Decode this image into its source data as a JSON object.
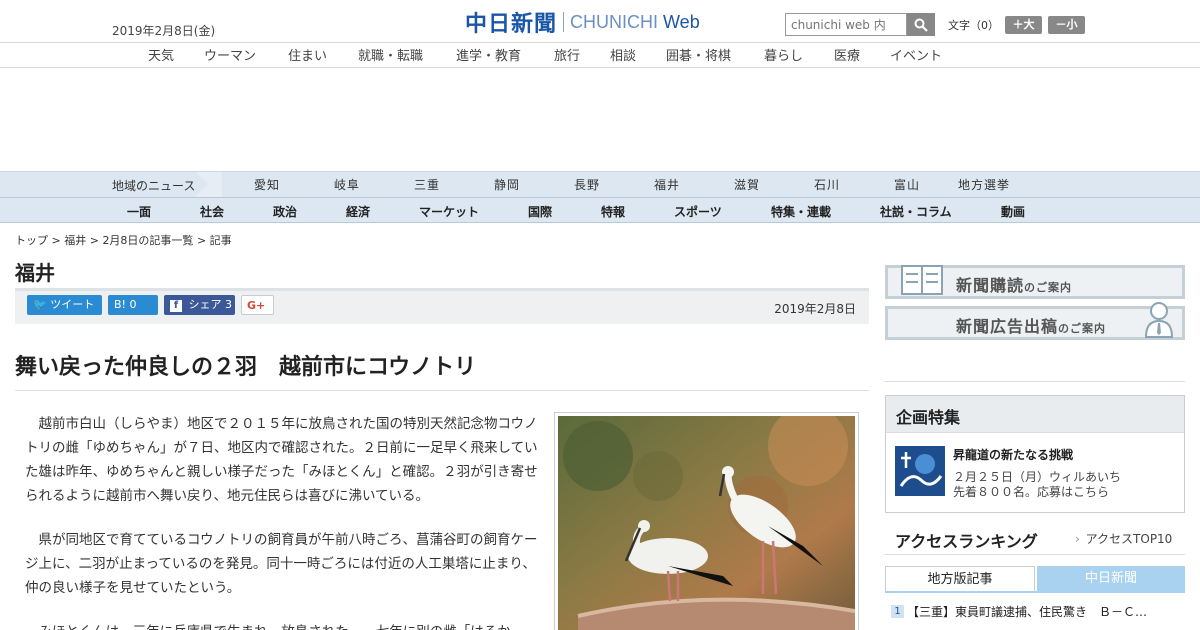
{
  "header": {
    "date": "2019年2月8日(金)",
    "logo_jp": "中日新聞",
    "logo_en": "CHUNICHI",
    "logo_web": "Web",
    "search_placeholder": "chunichi web 内",
    "font_label": "文字（0）",
    "font_up": "＋大",
    "font_down": "－小"
  },
  "global_nav": [
    "天気",
    "ウーマン",
    "住まい",
    "就職・転職",
    "進学・教育",
    "旅行",
    "相談",
    "囲碁・将棋",
    "暮らし",
    "医療",
    "イベント"
  ],
  "region_nav": {
    "label": "地域のニュース",
    "items": [
      "愛知",
      "岐阜",
      "三重",
      "静岡",
      "長野",
      "福井",
      "滋賀",
      "石川",
      "富山",
      "地方選挙"
    ]
  },
  "section_nav": [
    "一面",
    "社会",
    "政治",
    "経済",
    "マーケット",
    "国際",
    "特報",
    "スポーツ",
    "特集・連載",
    "社説・コラム",
    "動画"
  ],
  "breadcrumb": {
    "top": "トップ",
    "region": "福井",
    "list": "2月8日の記事一覧",
    "current": "記事",
    "sep": ">"
  },
  "section_title": "福井",
  "share": {
    "tweet": "ツイート",
    "hatena": "B! 0",
    "facebook": "シェア 3",
    "gplus": "G+",
    "date": "2019年2月8日"
  },
  "article": {
    "headline": "舞い戻った仲良しの２羽　越前市にコウノトリ",
    "paragraphs": [
      "越前市白山（しらやま）地区で２０１５年に放鳥された国の特別天然記念物コウノトリの雌「ゆめちゃん」が７日、地区内で確認された。２日前に一足早く飛来していた雄は昨年、ゆめちゃんと親しい様子だった「みほとくん」と確認。２羽が引き寄せられるように越前市へ舞い戻り、地元住民らは喜びに沸いている。",
      "県が同地区で育てているコウノトリの飼育員が午前八時ごろ、菖蒲谷町の飼育ケージ上に、二羽が止まっているのを発見。同十一時ごろには付近の人工巣塔に止まり、仲の良い様子を見せていたという。",
      "みほとくんは、三年に兵庫県で生まれ、放鳥された。一七年に別の雌「はるか"
    ]
  },
  "sidebar": {
    "banner1": {
      "main": "新聞購読",
      "sub": "のご案内"
    },
    "banner2": {
      "main": "新聞広告出稿",
      "sub": "のご案内"
    },
    "kikaku": {
      "heading": "企画特集",
      "title": "昇龍道の新たなる挑戦",
      "desc1": "２月２５日（月）ウィルあいち",
      "desc2": "先着８００名。応募はこちら"
    },
    "ranking": {
      "heading": "アクセスランキング",
      "link": "アクセスTOP10",
      "tab_local": "地方版記事",
      "tab_chunichi": "中日新聞",
      "items": [
        {
          "rank": "1",
          "text": "【三重】東員町議逮捕、住民驚き　Ｂ－Ｃ…"
        }
      ]
    }
  },
  "colors": {
    "brand": "#1a55a8",
    "nav_bg": "#dde7f1",
    "twitter": "#2a8bd2",
    "facebook": "#3b5998",
    "tab_inactive": "#a9d2f0"
  }
}
